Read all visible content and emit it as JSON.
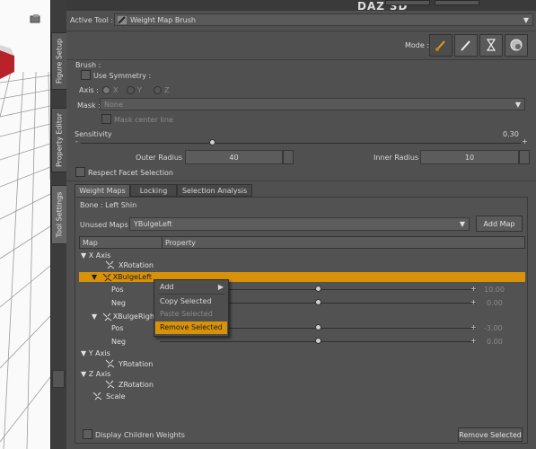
{
  "app": {
    "logo_text": "DAZ 3D"
  },
  "side_tabs": [
    {
      "label": "Figure Setup"
    },
    {
      "label": "Property Editor"
    },
    {
      "label": "Tool Settings"
    }
  ],
  "active_tool": {
    "label": "Active Tool :",
    "value": "Weight Map Brush"
  },
  "mode": {
    "label": "Mode :",
    "icons": [
      "brush-paint-icon",
      "brush-stroke-icon",
      "hourglass-icon",
      "gradient-icon"
    ]
  },
  "brush": {
    "section_label": "Brush :",
    "use_symmetry_label": "Use Symmetry :",
    "axis_label": "Axis :",
    "axis_options": [
      "X",
      "Y",
      "Z"
    ],
    "mask_label": "Mask :",
    "mask_value": "None",
    "mask_center_line_label": "Mask center line",
    "sensitivity_label": "Sensitivity",
    "sensitivity_value": "0.30",
    "sensitivity_level": 0.3,
    "outer_radius_label": "Outer Radius :",
    "outer_radius_value": "40",
    "inner_radius_label": "Inner Radius :",
    "inner_radius_value": "10",
    "respect_facet_label": "Respect Facet Selection"
  },
  "tabs": [
    {
      "label": "Weight Maps"
    },
    {
      "label": "Locking"
    },
    {
      "label": "Selection Analysis"
    }
  ],
  "bone": {
    "label": "Bone : Left Shin"
  },
  "unused_maps": {
    "label": "Unused Maps :",
    "value": "YBulgeLeft",
    "add_label": "Add Map"
  },
  "table": {
    "col_map": "Map",
    "col_property": "Property",
    "rows": [
      {
        "text": "X Axis"
      },
      {
        "text": "XRotation"
      },
      {
        "text": "XBulgeLeft"
      },
      {
        "text": "Pos",
        "value": "10.00"
      },
      {
        "text": "Neg",
        "value": "0.00"
      },
      {
        "text": "XBulgeRight"
      },
      {
        "text": "Pos",
        "value": "-3.00"
      },
      {
        "text": "Neg",
        "value": "0.00"
      },
      {
        "text": "Y Axis"
      },
      {
        "text": "YRotation"
      },
      {
        "text": "Z Axis"
      },
      {
        "text": "ZRotation"
      },
      {
        "text": "Scale"
      }
    ]
  },
  "context_menu": {
    "items": [
      {
        "label": "Add"
      },
      {
        "label": "Copy Selected"
      },
      {
        "label": "Paste Selected"
      },
      {
        "label": "Remove Selected"
      }
    ]
  },
  "footer": {
    "display_children_label": "Display Children Weights",
    "remove_selected_label": "Remove Selected"
  },
  "colors": {
    "highlight": "#d8920a",
    "panel": "#505050"
  }
}
